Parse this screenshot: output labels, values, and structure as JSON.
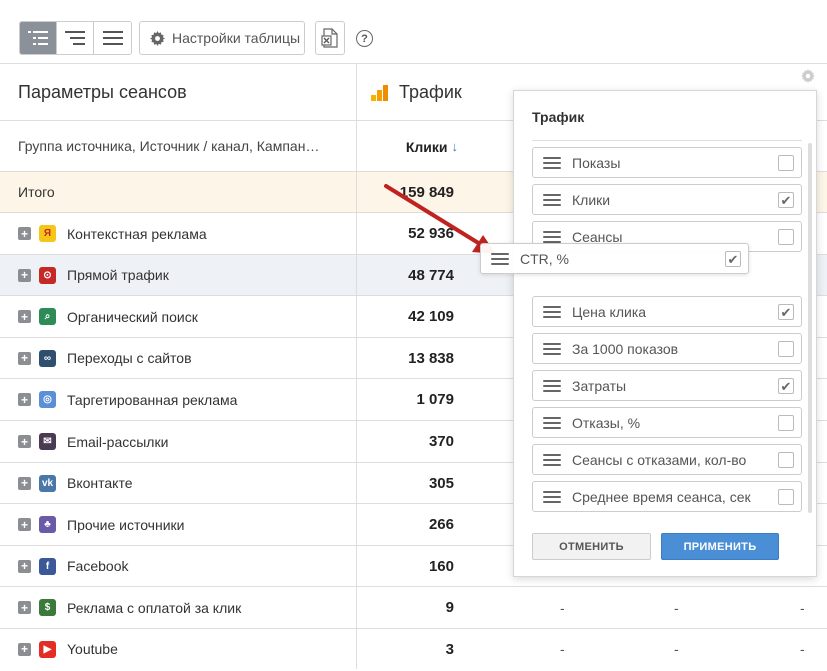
{
  "toolbar": {
    "view_buttons": [
      {
        "icon": "tree-view-icon",
        "active": true
      },
      {
        "icon": "indent-view-icon",
        "active": false
      },
      {
        "icon": "flat-view-icon",
        "active": false
      }
    ],
    "settings_label": "Настройки таблицы",
    "settings_icon": "gear-icon",
    "excel_icon": "excel-export-icon",
    "help_icon": "help-icon",
    "help_glyph": "?"
  },
  "table": {
    "params_header": "Параметры сеансов",
    "traffic_header": "Трафик",
    "grouping_header": "Группа источника, Источник / канал, Кампан…",
    "clicks_header": "Клики",
    "sort_glyph": "↓",
    "total": {
      "label": "Итого",
      "value": "159 849"
    },
    "rows": [
      {
        "label": "Контекстная реклама",
        "value": "52 936",
        "icon": "yandex-direct-icon",
        "color": "#f5c518",
        "glyph": "Я"
      },
      {
        "label": "Прямой трафик",
        "value": "48 774",
        "icon": "direct-traffic-icon",
        "color": "#c62828",
        "glyph": "⊙"
      },
      {
        "label": "Органический поиск",
        "value": "42 109",
        "icon": "search-icon",
        "color": "#2e8b57",
        "glyph": "⌕"
      },
      {
        "label": "Переходы с сайтов",
        "value": "13 838",
        "icon": "link-icon",
        "color": "#2f4f6f",
        "glyph": "∞"
      },
      {
        "label": "Таргетированная реклама",
        "value": "1 079",
        "icon": "target-icon",
        "color": "#5b8fd6",
        "glyph": "◎"
      },
      {
        "label": "Email-рассылки",
        "value": "370",
        "icon": "email-icon",
        "color": "#4a3b52",
        "glyph": "✉"
      },
      {
        "label": "Вконтакте",
        "value": "305",
        "icon": "vk-icon",
        "color": "#4a76a8",
        "glyph": "vk"
      },
      {
        "label": "Прочие источники",
        "value": "266",
        "icon": "other-sources-icon",
        "color": "#6a5aa8",
        "glyph": "♣"
      },
      {
        "label": "Facebook",
        "value": "160",
        "icon": "facebook-icon",
        "color": "#3b5998",
        "glyph": "f"
      },
      {
        "label": "Реклама с оплатой за клик",
        "value": "9",
        "icon": "ppc-icon",
        "color": "#3a7a3a",
        "glyph": "$"
      },
      {
        "label": "Youtube",
        "value": "3",
        "icon": "youtube-icon",
        "color": "#e52d27",
        "glyph": "▶"
      }
    ],
    "dash": "-"
  },
  "popup": {
    "title": "Трафик",
    "items": [
      {
        "label": "Показы",
        "checked": false
      },
      {
        "label": "Клики",
        "checked": true
      },
      {
        "label": "Сеансы",
        "checked": false
      },
      {
        "label": "Цена клика",
        "checked": true
      },
      {
        "label": "За 1000 показов",
        "checked": false
      },
      {
        "label": "Затраты",
        "checked": true
      },
      {
        "label": "Отказы, %",
        "checked": false
      },
      {
        "label": "Сеансы с отказами, кол-во",
        "checked": false
      },
      {
        "label": "Среднее время сеанса, сек",
        "checked": false
      }
    ],
    "dragged_item": {
      "label": "CTR, %",
      "checked": true
    },
    "check_glyph": "✔",
    "cancel_label": "ОТМЕНИТЬ",
    "apply_label": "ПРИМЕНИТЬ"
  },
  "colors": {
    "accent": "#4a8fd6",
    "arrow": "#c0221f",
    "total_row_bg": "#fdf5e8",
    "hover_row_bg": "#eef1f5"
  }
}
